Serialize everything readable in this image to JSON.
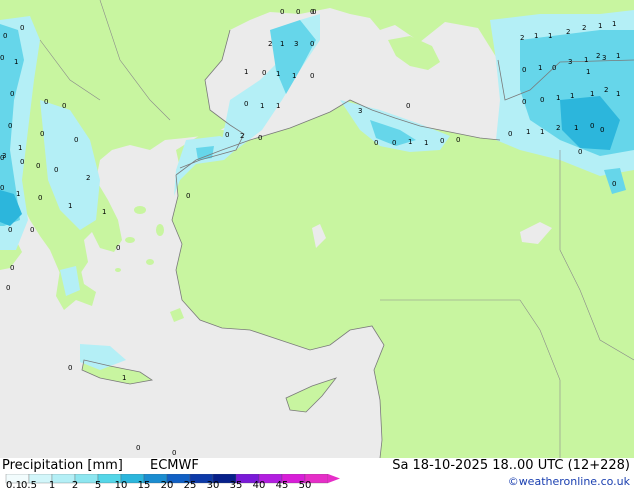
{
  "footer": {
    "title": "Precipitation [mm]",
    "model": "ECMWF",
    "valid_time": "Sa 18-10-2025 18..00 UTC (12+228)",
    "credit": "©weatheronline.co.uk"
  },
  "legend": {
    "ticks": [
      "0.1",
      "0.5",
      "1",
      "2",
      "5",
      "10",
      "15",
      "20",
      "25",
      "30",
      "35",
      "40",
      "45",
      "50"
    ],
    "colors": [
      "#f2fcfd",
      "#d2f6fa",
      "#b4eff6",
      "#8ee6f0",
      "#55d6e8",
      "#2cb6dc",
      "#1b8dd0",
      "#1160c4",
      "#0d3aa8",
      "#07208a",
      "#7a1ad8",
      "#b21ee0",
      "#d81ed8",
      "#e62ec8"
    ]
  },
  "colors": {
    "sea": "#ebebeb",
    "land": "#c8f5a0",
    "precip_light": "#b4eff6",
    "precip_mid": "#66d6ea",
    "precip_heavy": "#2cb6dc",
    "credit_link": "#1a3fb0"
  },
  "map": {
    "labels": [
      {
        "t": "0"
      },
      {
        "t": "0"
      },
      {
        "t": "0"
      },
      {
        "t": "1"
      },
      {
        "t": "0"
      },
      {
        "t": "0"
      },
      {
        "t": "0"
      },
      {
        "t": "0"
      },
      {
        "t": "0"
      },
      {
        "t": "1"
      },
      {
        "t": "0"
      },
      {
        "t": "0"
      },
      {
        "t": "0"
      },
      {
        "t": "0"
      },
      {
        "t": "0"
      },
      {
        "t": "0"
      },
      {
        "t": "3"
      },
      {
        "t": "0"
      },
      {
        "t": "1"
      },
      {
        "t": "2"
      },
      {
        "t": "1"
      },
      {
        "t": "0"
      },
      {
        "t": "0"
      },
      {
        "t": "0"
      },
      {
        "t": "0"
      },
      {
        "t": "0"
      },
      {
        "t": "0"
      },
      {
        "t": "3"
      },
      {
        "t": "0"
      },
      {
        "t": "0"
      },
      {
        "t": "0"
      },
      {
        "t": "1"
      },
      {
        "t": "0"
      },
      {
        "t": "0"
      },
      {
        "t": "0"
      },
      {
        "t": "1"
      },
      {
        "t": "1"
      },
      {
        "t": "1"
      },
      {
        "t": "2"
      },
      {
        "t": "0"
      },
      {
        "t": "1"
      },
      {
        "t": "2"
      },
      {
        "t": "0"
      },
      {
        "t": "1"
      },
      {
        "t": "0"
      },
      {
        "t": "1"
      },
      {
        "t": "1"
      },
      {
        "t": "3"
      },
      {
        "t": "0"
      },
      {
        "t": "1"
      },
      {
        "t": "0"
      },
      {
        "t": "0"
      },
      {
        "t": "0"
      },
      {
        "t": "1"
      },
      {
        "t": "2"
      },
      {
        "t": "2"
      },
      {
        "t": "1"
      },
      {
        "t": "1"
      },
      {
        "t": "2"
      },
      {
        "t": "2"
      },
      {
        "t": "1"
      },
      {
        "t": "3"
      },
      {
        "t": "1"
      },
      {
        "t": "3"
      },
      {
        "t": "1"
      },
      {
        "t": "0"
      },
      {
        "t": "0"
      },
      {
        "t": "1"
      },
      {
        "t": "0"
      },
      {
        "t": "2"
      },
      {
        "t": "0"
      },
      {
        "t": "1"
      },
      {
        "t": "1"
      },
      {
        "t": "1"
      },
      {
        "t": "1"
      },
      {
        "t": "1"
      },
      {
        "t": "0"
      },
      {
        "t": "0"
      },
      {
        "t": "0"
      },
      {
        "t": "0"
      },
      {
        "t": "1"
      },
      {
        "t": "0"
      },
      {
        "t": "1"
      },
      {
        "t": "2"
      },
      {
        "t": "0"
      },
      {
        "t": "0"
      },
      {
        "t": "1"
      },
      {
        "t": "0"
      },
      {
        "t": "0"
      },
      {
        "t": "1"
      },
      {
        "t": "0"
      }
    ]
  }
}
